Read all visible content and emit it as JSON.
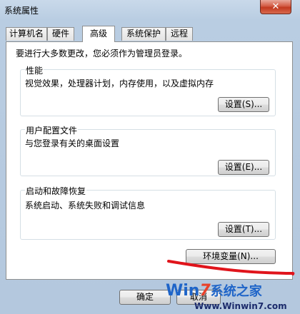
{
  "window": {
    "title": "系统属性",
    "close_glyph": "✕"
  },
  "tabs": [
    {
      "label": "计算机名"
    },
    {
      "label": "硬件"
    },
    {
      "label": "高级",
      "active": true
    },
    {
      "label": "系统保护"
    },
    {
      "label": "远程"
    }
  ],
  "intro": "要进行大多数更改，您必须作为管理员登录。",
  "groups": [
    {
      "title": "性能",
      "desc": "视觉效果，处理器计划，内存使用，以及虚拟内存",
      "button": "设置(S)..."
    },
    {
      "title": "用户配置文件",
      "desc": "与您登录有关的桌面设置",
      "button": "设置(E)..."
    },
    {
      "title": "启动和故障恢复",
      "desc": "系统启动、系统失败和调试信息",
      "button": "设置(T)..."
    }
  ],
  "env_button": "环境变量(N)...",
  "footer": {
    "ok": "确定",
    "cancel": "取消"
  },
  "watermark": {
    "logo_a": "Win",
    "logo_b": "7",
    "logo_c": "系统之家",
    "url": "Www.Winwin7.com"
  },
  "colors": {
    "annotation_stroke": "#e0141b",
    "panel_bg": "#ffffff",
    "close_button": "#c2391f"
  }
}
